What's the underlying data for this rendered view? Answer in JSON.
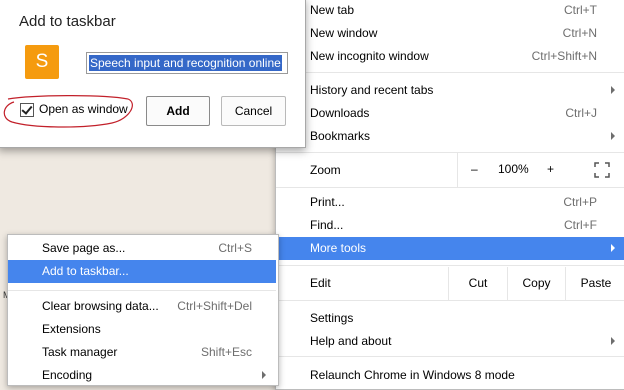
{
  "dialog": {
    "title": "Add to taskbar",
    "app_icon_letter": "S",
    "app_icon_color": "#f59b0f",
    "name_value": "Speech input and recognition online",
    "checkbox_label": "Open as window",
    "checkbox_checked": true,
    "add_label": "Add",
    "cancel_label": "Cancel"
  },
  "menu": {
    "new_tab": {
      "label": "New tab",
      "shortcut": "Ctrl+T"
    },
    "new_window": {
      "label": "New window",
      "shortcut": "Ctrl+N"
    },
    "new_incognito": {
      "label": "New incognito window",
      "shortcut": "Ctrl+Shift+N"
    },
    "history": {
      "label": "History and recent tabs"
    },
    "downloads": {
      "label": "Downloads",
      "shortcut": "Ctrl+J"
    },
    "bookmarks": {
      "label": "Bookmarks"
    },
    "zoom": {
      "label": "Zoom",
      "minus": "–",
      "value": "100%",
      "plus": "+",
      "fullscreen_icon": "fullscreen-icon"
    },
    "print": {
      "label": "Print...",
      "shortcut": "Ctrl+P"
    },
    "find": {
      "label": "Find...",
      "shortcut": "Ctrl+F"
    },
    "more_tools": {
      "label": "More tools"
    },
    "edit": {
      "label": "Edit",
      "cut": "Cut",
      "copy": "Copy",
      "paste": "Paste"
    },
    "settings": {
      "label": "Settings"
    },
    "help": {
      "label": "Help and about"
    },
    "relaunch": {
      "label": "Relaunch Chrome in Windows 8 mode"
    },
    "highlight_color": "#4585ed"
  },
  "submenu": {
    "save_page": {
      "label": "Save page as...",
      "shortcut": "Ctrl+S"
    },
    "add_to_taskbar": {
      "label": "Add to taskbar..."
    },
    "clear_browsing": {
      "label": "Clear browsing data...",
      "shortcut": "Ctrl+Shift+Del"
    },
    "extensions": {
      "label": "Extensions"
    },
    "task_manager": {
      "label": "Task manager",
      "shortcut": "Shift+Esc"
    },
    "encoding": {
      "label": "Encoding"
    }
  },
  "background": {
    "fragment": "M"
  }
}
